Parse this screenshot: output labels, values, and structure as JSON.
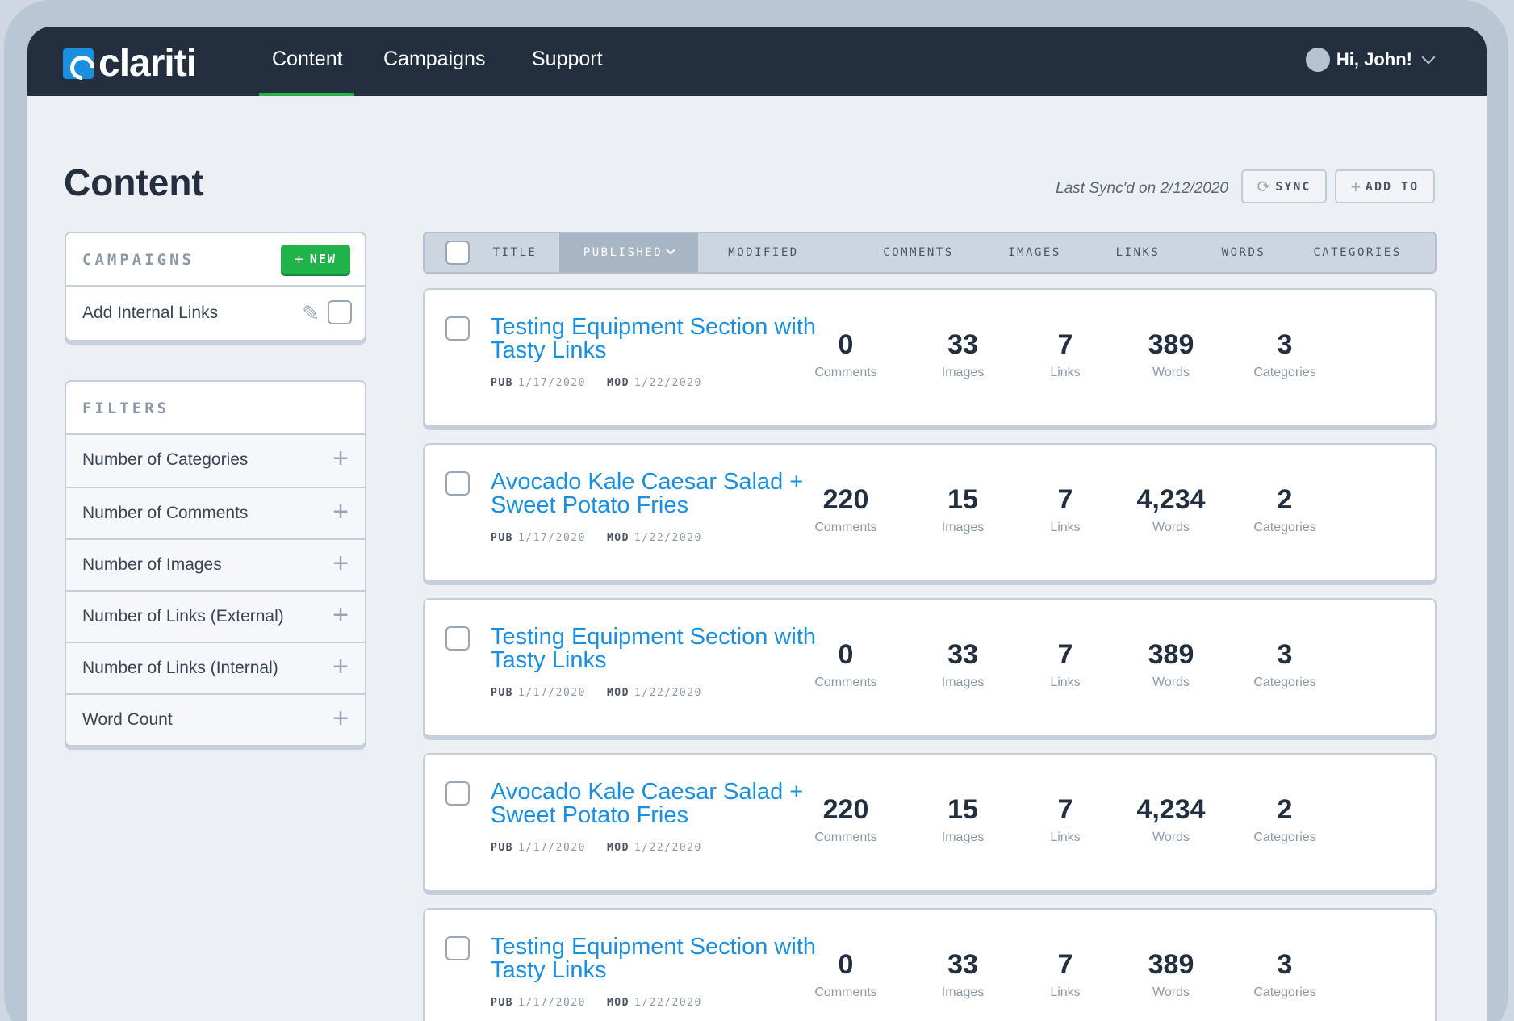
{
  "nav": {
    "brand": "clariti",
    "links": [
      "Content",
      "Campaigns",
      "Support"
    ],
    "active": "Content",
    "user_greeting": "Hi, John!"
  },
  "page": {
    "title": "Content",
    "last_sync": "Last Sync'd on 2/12/2020",
    "sync_label": "SYNC",
    "add_to_label": "ADD TO"
  },
  "campaigns": {
    "header": "CAMPAIGNS",
    "new_label": "NEW",
    "items": [
      {
        "label": "Add Internal Links"
      }
    ]
  },
  "filters": {
    "header": "FILTERS",
    "items": [
      {
        "label": "Number of Categories"
      },
      {
        "label": "Number of Comments"
      },
      {
        "label": "Number of Images"
      },
      {
        "label": "Number of Links (External)"
      },
      {
        "label": "Number of Links (Internal)"
      },
      {
        "label": "Word Count"
      }
    ]
  },
  "table": {
    "columns": [
      "TITLE",
      "PUBLISHED",
      "MODIFIED",
      "COMMENTS",
      "IMAGES",
      "LINKS",
      "WORDS",
      "CATEGORIES"
    ],
    "sorted_column": "PUBLISHED",
    "metric_units": [
      "Comments",
      "Images",
      "Links",
      "Words",
      "Categories"
    ],
    "pub_label": "PUB",
    "mod_label": "MOD",
    "rows": [
      {
        "title": "Testing Equipment Section with Tasty Links",
        "pub": "1/17/2020",
        "mod": "1/22/2020",
        "comments": "0",
        "images": "33",
        "links": "7",
        "words": "389",
        "categories": "3"
      },
      {
        "title": "Avocado Kale Caesar Salad + Sweet Potato Fries",
        "pub": "1/17/2020",
        "mod": "1/22/2020",
        "comments": "220",
        "images": "15",
        "links": "7",
        "words": "4,234",
        "categories": "2"
      },
      {
        "title": "Testing Equipment Section with Tasty Links",
        "pub": "1/17/2020",
        "mod": "1/22/2020",
        "comments": "0",
        "images": "33",
        "links": "7",
        "words": "389",
        "categories": "3"
      },
      {
        "title": "Avocado Kale Caesar Salad + Sweet Potato Fries",
        "pub": "1/17/2020",
        "mod": "1/22/2020",
        "comments": "220",
        "images": "15",
        "links": "7",
        "words": "4,234",
        "categories": "2"
      },
      {
        "title": "Testing Equipment Section with Tasty Links",
        "pub": "1/17/2020",
        "mod": "1/22/2020",
        "comments": "0",
        "images": "33",
        "links": "7",
        "words": "389",
        "categories": "3"
      }
    ]
  },
  "colors": {
    "nav_bg": "#232f3e",
    "accent_blue": "#1a8fe0",
    "accent_green": "#1fb34a",
    "page_bg": "#eceff4"
  },
  "icons": [
    "clariti-logo-icon",
    "chevron-down-icon",
    "refresh-icon",
    "plus-icon",
    "pencil-icon",
    "checkbox-icon"
  ]
}
